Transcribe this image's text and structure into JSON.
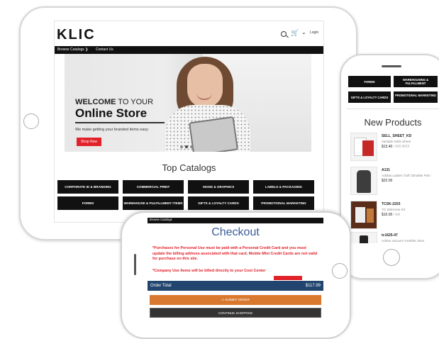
{
  "tablet": {
    "logo": "KLIC",
    "login": "Login",
    "nav": [
      "Browse Catalogs ❯",
      "Contact Us"
    ],
    "hero": {
      "welcome_bold": "WELCOME",
      "welcome_rest": " TO YOUR",
      "store": "Online Store",
      "subtitle": "We make getting your branded items easy",
      "shop_button": "Shop Now"
    },
    "top_catalogs_title": "Top Catalogs",
    "catalogs": [
      "CORPORATE ID & BRANDING",
      "COMMERCIAL PRINT",
      "SIGNS & GRAPHICS",
      "LABELS & PACKAGING",
      "FORMS",
      "WAREHOUSE & FULFILLMENT ITEMS",
      "GIFTS & LOYALTY CARDS",
      "PROMOTIONAL MARKETING"
    ]
  },
  "phone": {
    "buttons": [
      "FORMS",
      "WAREHOUSING & FULFILLMENT",
      "GIFTS & LOYALTY CARDS",
      "PROMOTIONAL MARKETING"
    ],
    "new_products_title": "New Products",
    "products": [
      {
        "sku": "SELL_SHEET_KD",
        "desc": "Variable Sells Sheet",
        "price": "$13.40",
        "unit": " / 500 BOX"
      },
      {
        "sku": "A131",
        "desc": "Adidas Ladies' Golf Climalite Polo",
        "price": "$22.00",
        "unit": ""
      },
      {
        "sku": "TCSK-2203",
        "desc": "TC Welcome Kit",
        "price": "$10.00",
        "unit": " / EA"
      },
      {
        "sku": "tc1625-47",
        "desc": "Adrian Vacuum Tumbler 20oz",
        "price": "",
        "unit": ""
      }
    ]
  },
  "checkout": {
    "top_label": "Browse Catalogs",
    "title": "Checkout",
    "note1": "*Purchases for Personal Use must be paid with a Personal Credit Card and you must update the billing address associated with that card. Mobile Mini Credit Cards are not valid for purchase on this site.",
    "note2": "*Company Use Items will be billed directly to your Cost Center",
    "order_total_label": "Order Total",
    "order_total_value": "$117.99",
    "submit_label": "⚠ SUBMIT ORDER",
    "continue_label": "CONTINUE SHOPPING"
  },
  "colors": {
    "brand_red": "#e2222a",
    "checkout_blue": "#3b5c9a",
    "order_bar": "#22456f",
    "submit_orange": "#d9792f"
  }
}
